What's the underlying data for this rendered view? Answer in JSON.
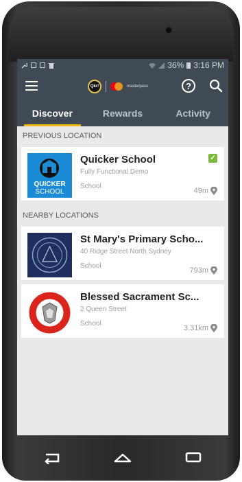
{
  "status": {
    "battery": "36%",
    "time": "3:16 PM"
  },
  "appbar": {
    "qkr_logo_text": "Qkr!",
    "mp_text": "masterpass"
  },
  "tabs": [
    {
      "label": "Discover",
      "active": true
    },
    {
      "label": "Rewards",
      "active": false
    },
    {
      "label": "Activity",
      "active": false
    }
  ],
  "sections": {
    "previous": "PREVIOUS LOCATION",
    "nearby": "NEARBY LOCATIONS"
  },
  "locations": [
    {
      "title": "Quicker School",
      "subtitle": "Fully Functional Demo",
      "type": "School",
      "distance": "49m",
      "logo_text_1": "QUICKER",
      "logo_text_2": "SCHOOL"
    },
    {
      "title": "St Mary's Primary Scho...",
      "subtitle": "40 Ridge Street North Sydney",
      "type": "School",
      "distance": "793m"
    },
    {
      "title": "Blessed Sacrament Sc...",
      "subtitle": "2 Queen Street",
      "type": "School",
      "distance": "3.31km"
    }
  ],
  "colors": {
    "appbar": "#404a55",
    "tab_indicator": "#f2b600",
    "check": "#7bb93a"
  }
}
